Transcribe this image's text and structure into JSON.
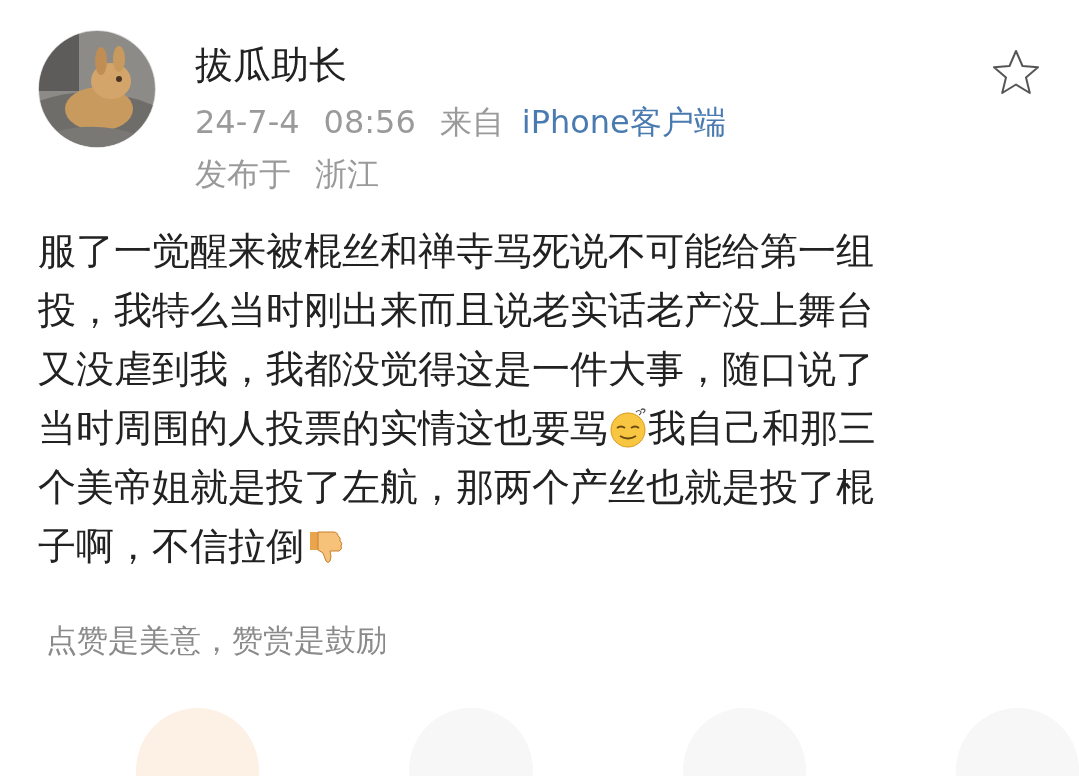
{
  "author": {
    "name": "拔瓜助长",
    "date": "24-7-4",
    "time": "08:56",
    "source_prefix": "来自",
    "source": "iPhone客户端",
    "location_prefix": "发布于",
    "location": "浙江",
    "favorited": false
  },
  "post": {
    "lines": [
      {
        "segments": [
          {
            "kind": "text",
            "text": "服了一觉醒来被棍丝和禅寺骂死说不可能给第一组"
          }
        ]
      },
      {
        "segments": [
          {
            "kind": "text",
            "text": "投，我特么当时刚出来而且说老实话老产没上舞台"
          }
        ]
      },
      {
        "segments": [
          {
            "kind": "text",
            "text": "又没虐到我，我都没觉得这是一件大事，随口说了"
          }
        ]
      },
      {
        "segments": [
          {
            "kind": "text",
            "text": "当时周围的人投票的实情这也要骂"
          },
          {
            "kind": "face"
          },
          {
            "kind": "text",
            "text": "我自己和那三"
          }
        ]
      },
      {
        "segments": [
          {
            "kind": "text",
            "text": "个美帝姐就是投了左航，那两个产丝也就是投了棍"
          }
        ]
      },
      {
        "segments": [
          {
            "kind": "text",
            "text": "子啊，不信拉倒"
          },
          {
            "kind": "thumbs-down"
          }
        ]
      }
    ]
  },
  "reward": {
    "slogan": "点赞是美意，赞赏是鼓励"
  }
}
